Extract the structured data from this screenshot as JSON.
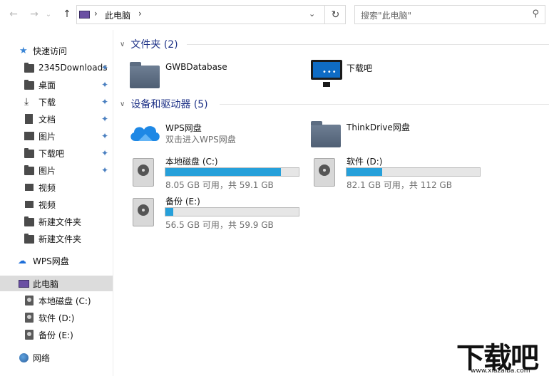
{
  "address_bar": {
    "back_icon": "←",
    "forward_icon": "→",
    "dropdown_icon": "⌄",
    "up_icon": "↑",
    "crumb_sep": "›",
    "crumb": "此电脑",
    "crumb_end_sep": "›",
    "path_dropdown_icon": "⌄",
    "refresh_icon": "↻"
  },
  "search": {
    "placeholder": "搜索\"此电脑\"",
    "icon": "⚲"
  },
  "sidebar": {
    "quick_access": "快速访问",
    "items": [
      {
        "label": "2345Downloads",
        "icon": "folder-icon",
        "pinned": true
      },
      {
        "label": "桌面",
        "icon": "folder-icon",
        "pinned": true
      },
      {
        "label": "下载",
        "icon": "download-icon",
        "pinned": true
      },
      {
        "label": "文档",
        "icon": "document-icon",
        "pinned": true
      },
      {
        "label": "图片",
        "icon": "picture-icon",
        "pinned": true
      },
      {
        "label": "下载吧",
        "icon": "folder-icon",
        "pinned": true
      },
      {
        "label": "图片",
        "icon": "folder-icon",
        "pinned": true
      },
      {
        "label": "视频",
        "icon": "video-icon",
        "pinned": false
      },
      {
        "label": "视频",
        "icon": "video-icon",
        "pinned": false
      },
      {
        "label": "新建文件夹",
        "icon": "folder-icon",
        "pinned": false
      },
      {
        "label": "新建文件夹",
        "icon": "folder-icon",
        "pinned": false
      }
    ],
    "wps_cloud": "WPS网盘",
    "this_pc": "此电脑",
    "drives": [
      {
        "label": "本地磁盘 (C:)"
      },
      {
        "label": "软件 (D:)"
      },
      {
        "label": "备份 (E:)"
      }
    ],
    "network": "网络",
    "pin_glyph": "📌"
  },
  "main": {
    "folders_header": "文件夹 (2)",
    "folders": [
      {
        "name": "GWBDatabase"
      },
      {
        "name": "下载吧"
      }
    ],
    "devices_header": "设备和驱动器 (5)",
    "wps": {
      "name": "WPS网盘",
      "sub": "双击进入WPS网盘"
    },
    "thinkdrive": {
      "name": "ThinkDrive网盘"
    },
    "drives": [
      {
        "name": "本地磁盘 (C:)",
        "free": "8.05 GB 可用，共 59.1 GB",
        "used_fraction": 0.864
      },
      {
        "name": "软件 (D:)",
        "free": "82.1 GB 可用，共 112 GB",
        "used_fraction": 0.267
      },
      {
        "name": "备份 (E:)",
        "free": "56.5 GB 可用，共 59.9 GB",
        "used_fraction": 0.057
      }
    ],
    "chevron": "∨"
  },
  "watermark": {
    "brand": "下载吧",
    "url": "www.xiazaiba.com"
  },
  "colors": {
    "accent": "#26a0da",
    "header_text": "#1e3287",
    "selected_bg": "#dcdcdc"
  }
}
